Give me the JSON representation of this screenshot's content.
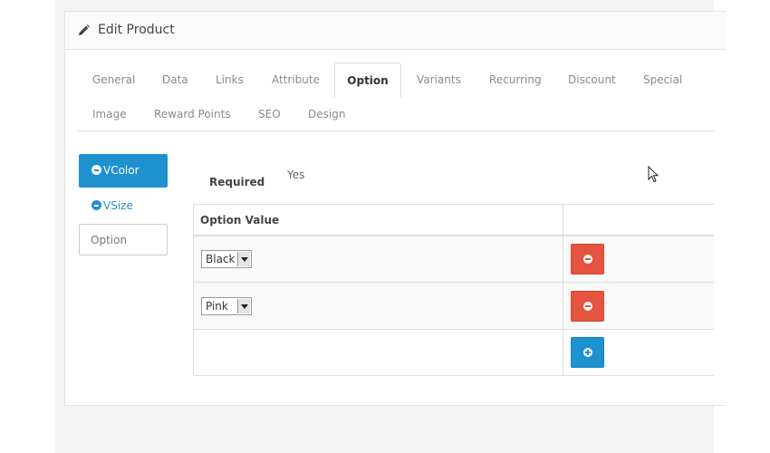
{
  "panel": {
    "title": "Edit Product",
    "title_icon": "pencil-icon"
  },
  "tabs": {
    "items": [
      "General",
      "Data",
      "Links",
      "Attribute",
      "Option",
      "Variants",
      "Recurring",
      "Discount",
      "Special",
      "Image",
      "Reward Points",
      "SEO",
      "Design"
    ],
    "active": "Option"
  },
  "options": {
    "items": [
      {
        "label": "VColor",
        "active": true,
        "icon": "minus-circle-icon"
      },
      {
        "label": "VSize",
        "active": false,
        "icon": "minus-circle-icon"
      }
    ],
    "input_placeholder": "Option"
  },
  "required": {
    "label": "Required",
    "value": "Yes"
  },
  "table": {
    "header": "Option Value",
    "rows": [
      {
        "value": "Black",
        "action_icon": "minus-circle-icon"
      },
      {
        "value": "Pink",
        "action_icon": "minus-circle-icon"
      }
    ],
    "add_icon": "plus-circle-icon"
  },
  "colors": {
    "primary": "#1e91cf",
    "danger": "#e4543f"
  }
}
